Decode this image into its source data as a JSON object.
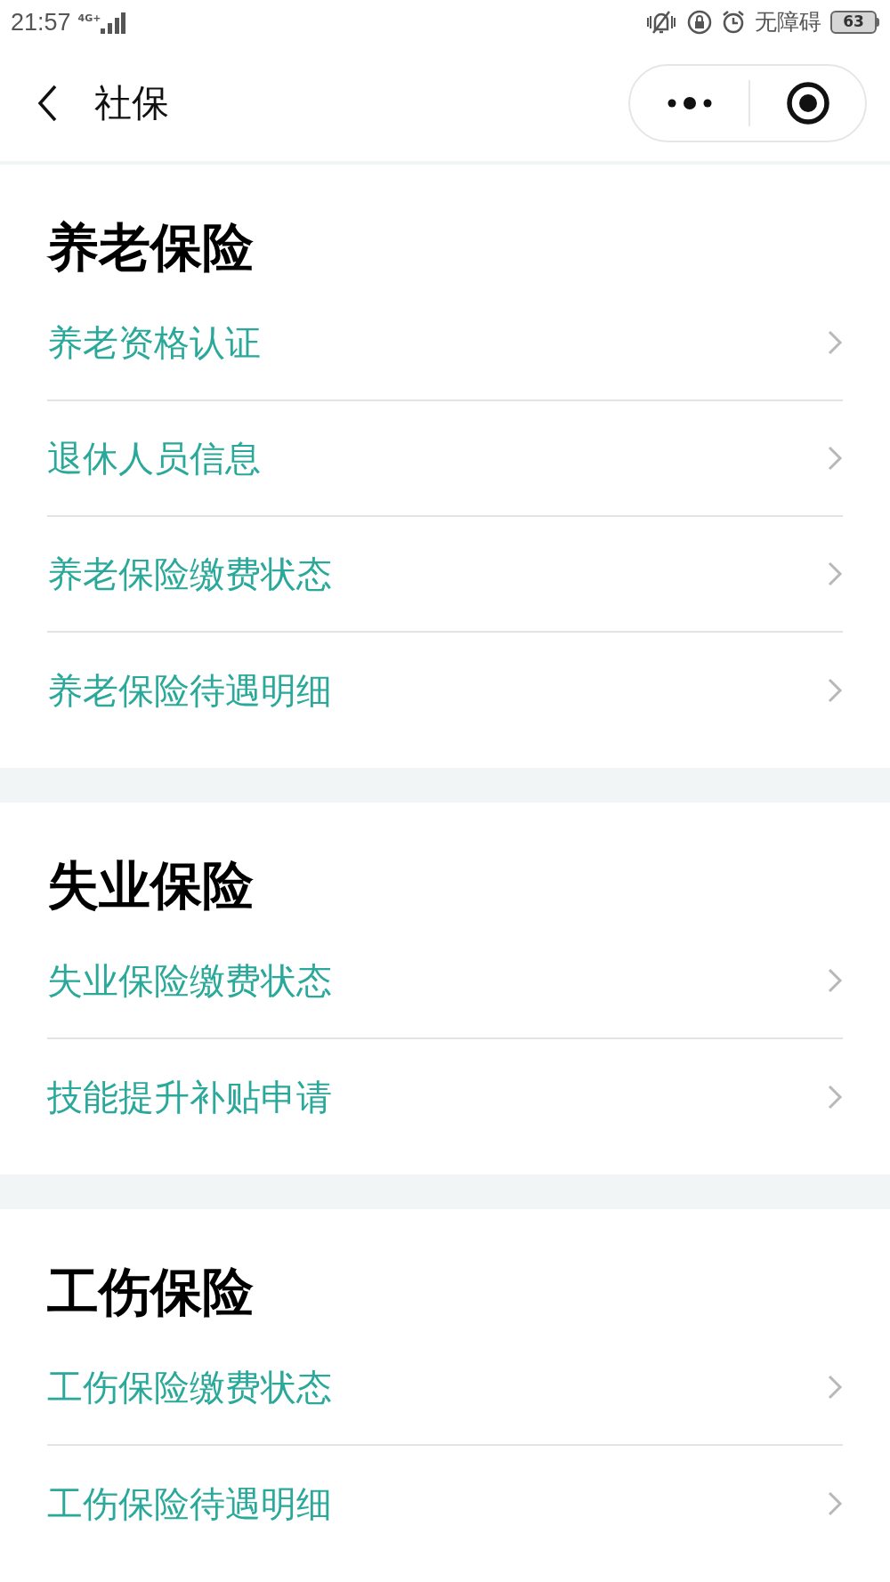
{
  "status_bar": {
    "time": "21:57",
    "network": "4G+",
    "accessibility": "无障碍",
    "battery": "63"
  },
  "nav": {
    "title": "社保"
  },
  "sections": [
    {
      "title": "养老保险",
      "items": [
        "养老资格认证",
        "退休人员信息",
        "养老保险缴费状态",
        "养老保险待遇明细"
      ]
    },
    {
      "title": "失业保险",
      "items": [
        "失业保险缴费状态",
        "技能提升补贴申请"
      ]
    },
    {
      "title": "工伤保险",
      "items": [
        "工伤保险缴费状态",
        "工伤保险待遇明细"
      ]
    }
  ]
}
